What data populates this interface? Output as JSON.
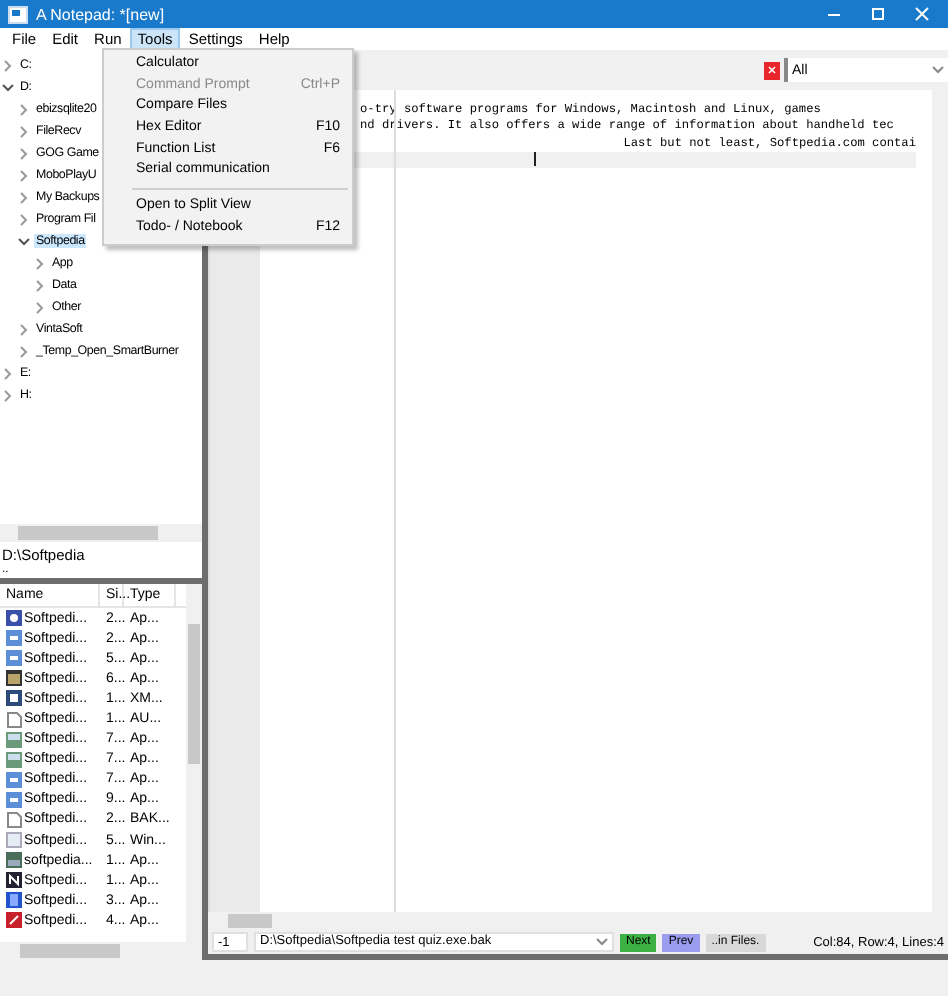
{
  "window": {
    "title": "A Notepad: *[new]"
  },
  "menu": [
    {
      "label": "File",
      "selected": false
    },
    {
      "label": "Edit",
      "selected": false
    },
    {
      "label": "Run",
      "selected": false
    },
    {
      "label": "Tools",
      "selected": true
    },
    {
      "label": "Settings",
      "selected": false
    },
    {
      "label": "Help",
      "selected": false
    }
  ],
  "dropdown": [
    {
      "label": "Calculator",
      "disabled": false
    },
    {
      "label": "Command Prompt",
      "shortcut": "Ctrl+P",
      "disabled": true
    },
    {
      "label": "Compare Files",
      "disabled": false
    },
    {
      "label": "Hex Editor",
      "shortcut": "F10",
      "disabled": false
    },
    {
      "label": "Function List",
      "shortcut": "F6",
      "disabled": false
    },
    {
      "label": "Serial communication",
      "disabled": false
    },
    {
      "kind": "separator"
    },
    {
      "label": "Open to Split View",
      "disabled": false
    },
    {
      "label": "Todo- / Notebook",
      "shortcut": "F12",
      "disabled": false
    }
  ],
  "tree": [
    {
      "label": "C:",
      "expanded": false,
      "selected": false
    },
    {
      "label": "D:",
      "expanded": true,
      "selected": false,
      "children": [
        {
          "label": "ebizsqlite20",
          "expanded": false,
          "selected": false
        },
        {
          "label": "FileRecv",
          "expanded": false,
          "selected": false
        },
        {
          "label": "GOG Game",
          "expanded": false,
          "selected": false
        },
        {
          "label": "MoboPlayU",
          "expanded": false,
          "selected": false
        },
        {
          "label": "My Backups",
          "expanded": false,
          "selected": false
        },
        {
          "label": "Program Fil",
          "expanded": false,
          "selected": false
        },
        {
          "label": "Softpedia",
          "expanded": true,
          "selected": true,
          "children": [
            {
              "label": "App",
              "expanded": false,
              "selected": false
            },
            {
              "label": "Data",
              "expanded": false,
              "selected": false
            },
            {
              "label": "Other",
              "expanded": false,
              "selected": false
            }
          ]
        },
        {
          "label": "VintaSoft",
          "expanded": false,
          "selected": false
        },
        {
          "label": "_Temp_Open_SmartBurner",
          "expanded": false,
          "selected": false
        }
      ]
    },
    {
      "label": "E:",
      "expanded": false,
      "selected": false
    },
    {
      "label": "H:",
      "expanded": false,
      "selected": false
    }
  ],
  "current_path": "D:\\Softpedia",
  "parent_entry": "..",
  "file_list": {
    "columns": [
      "Name",
      "Si...",
      "Type"
    ],
    "rows": [
      [
        "Softpedi...",
        "2...",
        "Ap..."
      ],
      [
        "Softpedi...",
        "2...",
        "Ap..."
      ],
      [
        "Softpedi...",
        "5...",
        "Ap..."
      ],
      [
        "Softpedi...",
        "6...",
        "Ap..."
      ],
      [
        "Softpedi...",
        "1...",
        "XM..."
      ],
      [
        "Softpedi...",
        "1...",
        "AU..."
      ],
      [
        "Softpedi...",
        "7...",
        "Ap..."
      ],
      [
        "Softpedi...",
        "7...",
        "Ap..."
      ],
      [
        "Softpedi...",
        "7...",
        "Ap..."
      ],
      [
        "Softpedi...",
        "9...",
        "Ap..."
      ],
      [
        "Softpedi...",
        "2...",
        "BAK..."
      ],
      [
        "Softpedi...",
        "5...",
        "Win..."
      ],
      [
        "softpedia...",
        "1...",
        "Ap..."
      ],
      [
        "Softpedi...",
        "1...",
        "Ap..."
      ],
      [
        "Softpedi...",
        "3...",
        "Ap..."
      ],
      [
        "Softpedi...",
        "4...",
        "Ap..."
      ]
    ]
  },
  "filter": {
    "value": "All"
  },
  "editor": {
    "lines": [
      {
        "text": "o-try software programs for Windows, Macintosh and Linux, games",
        "current": false
      },
      {
        "text": "nd drivers. It also offers a wide range of information about handheld tec",
        "current": false
      },
      {
        "text": "Last but not least, Softpedia.com contai",
        "current": false
      },
      {
        "current": true
      }
    ]
  },
  "status": {
    "line_field": "-1",
    "file_path": "D:\\Softpedia\\Softpedia test quiz.exe.bak",
    "buttons": [
      {
        "label": "Next",
        "color": "#3cb043"
      },
      {
        "label": "Prev",
        "color": "#9a9cf0"
      },
      {
        "label": "..in Files.",
        "color": "#d8d8d8"
      }
    ],
    "position": "Col:84, Row:4, Lines:4"
  }
}
